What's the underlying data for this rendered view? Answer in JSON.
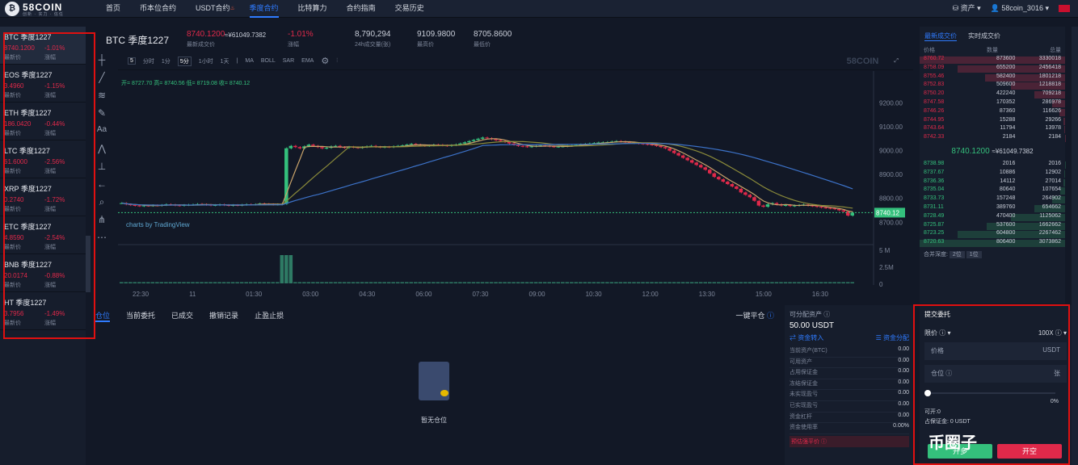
{
  "nav": {
    "logo": "58COIN",
    "logo_sub": "创新 · 实力 · 信任",
    "items": [
      "首页",
      "币本位合约",
      "USDT合约",
      "季度合约",
      "比特算力",
      "合约指南",
      "交易历史"
    ],
    "assets": "资产",
    "user": "58coin_3016"
  },
  "markets": [
    {
      "name": "BTC 季度1227",
      "price": "8740.1200",
      "change": "-1.01%",
      "l1": "最新价",
      "l2": "涨幅"
    },
    {
      "name": "EOS 季度1227",
      "price": "3.4960",
      "change": "-1.15%",
      "l1": "最新价",
      "l2": "涨幅"
    },
    {
      "name": "ETH 季度1227",
      "price": "186.0420",
      "change": "-0.44%",
      "l1": "最新价",
      "l2": "涨幅"
    },
    {
      "name": "LTC 季度1227",
      "price": "61.6000",
      "change": "-2.56%",
      "l1": "最新价",
      "l2": "涨幅"
    },
    {
      "name": "XRP 季度1227",
      "price": "0.2740",
      "change": "-1.72%",
      "l1": "最新价",
      "l2": "涨幅"
    },
    {
      "name": "ETC 季度1227",
      "price": "4.8590",
      "change": "-2.54%",
      "l1": "最新价",
      "l2": "涨幅"
    },
    {
      "name": "BNB 季度1227",
      "price": "20.0174",
      "change": "-0.88%",
      "l1": "最新价",
      "l2": "涨幅"
    },
    {
      "name": "HT 季度1227",
      "price": "3.7956",
      "change": "-1.49%",
      "l1": "最新价",
      "l2": "涨幅"
    }
  ],
  "ticker": {
    "symbol": "BTC 季度1227",
    "price": "8740.1200",
    "price_cny": "≈¥61049.7382",
    "price_label": "最新成交价",
    "change": "-1.01%",
    "change_label": "涨幅",
    "vol": "8,790,294",
    "vol_label": "24h成交量(张)",
    "high": "9109.9800",
    "high_label": "最高价",
    "low": "8705.8600",
    "low_label": "最低价"
  },
  "toolbar": {
    "items": [
      "分时",
      "1分",
      "5分",
      "1小时",
      "1天",
      "MA",
      "BOLL",
      "SAR",
      "EMA"
    ],
    "active": "5分",
    "interval_box": "5",
    "watermark": "58COIN"
  },
  "chart_data": {
    "type": "candlestick",
    "ohlc_label": "开= 8727.70  高= 8740.56  低= 8719.08  收= 8740.12",
    "brand": "charts by TradingView",
    "last_price": "8740.12",
    "ylim": [
      8640,
      9300
    ],
    "y_ticks": [
      "9200.00",
      "9100.00",
      "9000.00",
      "8900.00",
      "8800.00",
      "8700.00"
    ],
    "vol_ticks": [
      "5 M",
      "2.5M",
      "0"
    ],
    "x_ticks": [
      "22:30",
      "11",
      "01:30",
      "03:00",
      "04:30",
      "06:00",
      "07:30",
      "09:00",
      "10:30",
      "12:00",
      "13:30",
      "15:00",
      "16:30"
    ],
    "close_series": [
      8780,
      8775,
      8772,
      8770,
      8768,
      8770,
      8769,
      8771,
      8770,
      8772,
      8775,
      8773,
      8771,
      8770,
      8772,
      8773,
      8774,
      8776,
      8775,
      8773,
      8771,
      8772,
      8774,
      8772,
      8770,
      8772,
      8771,
      8773,
      8775,
      8774,
      8775,
      8778,
      8776,
      8775,
      8774,
      8775,
      8777,
      9010,
      9020,
      9015,
      9010,
      9018,
      9025,
      9020,
      9015,
      9010,
      9012,
      9018,
      9020,
      9015,
      9012,
      9016,
      9014,
      9012,
      9015,
      9018,
      9020,
      9016,
      9014,
      9016,
      9015,
      9018,
      9020,
      9022,
      9025,
      9028,
      9025,
      9022,
      9020,
      9022,
      9025,
      9024,
      9022,
      9020,
      9023,
      9026,
      9030,
      9035,
      9040,
      9045,
      9050,
      9055,
      9052,
      9048,
      9044,
      9040,
      9036,
      9030,
      9025,
      9020,
      9018,
      9016,
      9018,
      9020,
      9022,
      9020,
      9018,
      9016,
      9017,
      9018,
      9020,
      9022,
      9024,
      9026,
      9028,
      9030,
      9032,
      9034,
      9035,
      9036,
      9038,
      9040,
      9038,
      9036,
      9034,
      9032,
      9030,
      9028,
      9026,
      9024,
      9020,
      9015,
      9010,
      9000,
      8990,
      8980,
      8970,
      8960,
      8950,
      8940,
      8930,
      8920,
      8905,
      8890,
      8880,
      8870,
      8860,
      8850,
      8840,
      8825,
      8815,
      8805,
      8790,
      8770,
      8765,
      8775,
      8780,
      8775,
      8770,
      8772,
      8768,
      8770,
      8772,
      8774,
      8770,
      8768,
      8765,
      8762,
      8760,
      8758,
      8755,
      8750,
      8745,
      8728,
      8740
    ]
  },
  "orderbook": {
    "tabs": [
      "最新成交价",
      "实时成交价"
    ],
    "headers": [
      "价格",
      "数量",
      "总量"
    ],
    "asks": [
      [
        "8760.72",
        "873600",
        "3330018",
        1.0
      ],
      [
        "8758.09",
        "655200",
        "2456418",
        0.74
      ],
      [
        "8755.46",
        "582400",
        "1801218",
        0.55
      ],
      [
        "8752.83",
        "509600",
        "1218818",
        0.37
      ],
      [
        "8750.20",
        "422240",
        "709218",
        0.21
      ],
      [
        "8747.58",
        "170352",
        "286978",
        0.09
      ],
      [
        "8746.26",
        "87360",
        "116626",
        0.04
      ],
      [
        "8744.95",
        "15288",
        "29266",
        0.01
      ],
      [
        "8743.64",
        "11794",
        "13978",
        0.005
      ],
      [
        "8742.33",
        "2184",
        "2184",
        0.001
      ]
    ],
    "mid_price": "8740.1200",
    "mid_cny": "≈¥61049.7382",
    "bids": [
      [
        "8738.98",
        "2016",
        "2016",
        0.001
      ],
      [
        "8737.67",
        "10886",
        "12902",
        0.004
      ],
      [
        "8736.36",
        "14112",
        "27014",
        0.009
      ],
      [
        "8735.04",
        "80640",
        "107654",
        0.035
      ],
      [
        "8733.73",
        "157248",
        "264902",
        0.09
      ],
      [
        "8731.11",
        "389760",
        "654662",
        0.21
      ],
      [
        "8728.49",
        "470400",
        "1125062",
        0.37
      ],
      [
        "8725.87",
        "537600",
        "1662662",
        0.54
      ],
      [
        "8723.25",
        "604800",
        "2267462",
        0.74
      ],
      [
        "8720.63",
        "806400",
        "3073862",
        1.0
      ]
    ],
    "merge_label": "合并深度:",
    "merge_opts": [
      "2位",
      "1位"
    ]
  },
  "positions": {
    "tabs": [
      "仓位",
      "当前委托",
      "已成交",
      "撤销记录",
      "止盈止损"
    ],
    "close_all": "一键平仓",
    "empty": "暂无仓位"
  },
  "account": {
    "title": "可分配资产",
    "amount": "50.00 USDT",
    "transfer_in": "资金转入",
    "allocate": "资金分配",
    "rows": [
      [
        "当前资产(BTC)",
        "0.00"
      ],
      [
        "可用资产",
        "0.00"
      ],
      [
        "占用保证金",
        "0.00"
      ],
      [
        "冻结保证金",
        "0.00"
      ],
      [
        "未实现盈亏",
        "0.00"
      ],
      [
        "已实现盈亏",
        "0.00"
      ],
      [
        "资金杠杆",
        "0.00"
      ],
      [
        "资金使用率",
        "0.00%"
      ]
    ],
    "predict": "预估强平价"
  },
  "order": {
    "title": "提交委托",
    "type": "限价",
    "leverage": "100X",
    "price_label": "价格",
    "price_unit": "USDT",
    "qty_label": "仓位",
    "qty_unit": "张",
    "pct": "0%",
    "avail": "可开:0",
    "margin": "占保证金: 0 USDT",
    "buy": "开多",
    "sell": "开空"
  },
  "watermark_overlay": "币圈子",
  "colors": {
    "up": "#34c07c",
    "down": "#e0294a",
    "accent": "#2f7bff",
    "bg": "#121826"
  }
}
